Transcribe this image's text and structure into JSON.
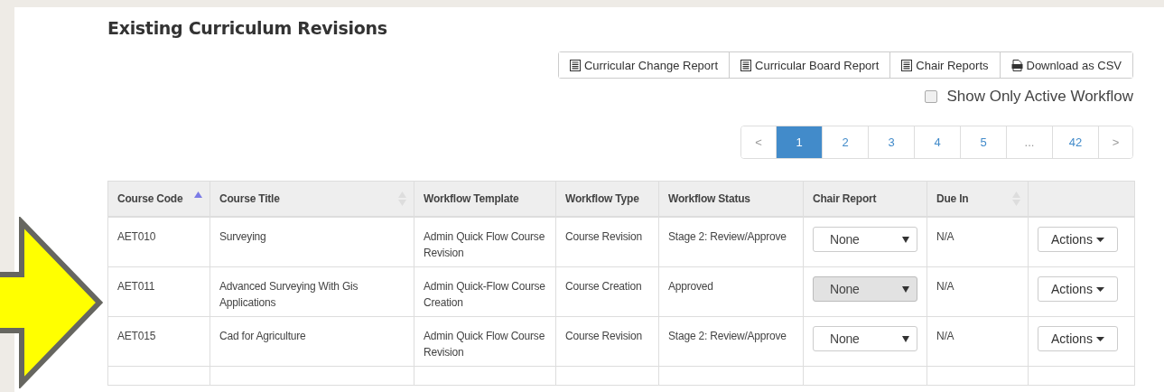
{
  "page": {
    "title": "Existing Curriculum Revisions"
  },
  "report_buttons": [
    {
      "label": "Curricular Change Report",
      "kind": "report"
    },
    {
      "label": "Curricular Board Report",
      "kind": "report"
    },
    {
      "label": "Chair Reports",
      "kind": "report"
    },
    {
      "label": "Download as CSV",
      "kind": "csv"
    }
  ],
  "active_filter": {
    "label": "Show Only Active Workflow",
    "checked": false
  },
  "pagination": [
    {
      "label": "<",
      "selected": false,
      "kind": "nav"
    },
    {
      "label": "1",
      "selected": true,
      "kind": "page"
    },
    {
      "label": "2",
      "selected": false,
      "kind": "page"
    },
    {
      "label": "3",
      "selected": false,
      "kind": "page"
    },
    {
      "label": "4",
      "selected": false,
      "kind": "page"
    },
    {
      "label": "5",
      "selected": false,
      "kind": "page"
    },
    {
      "label": "...",
      "selected": false,
      "kind": "nav"
    },
    {
      "label": "42",
      "selected": false,
      "kind": "page"
    },
    {
      "label": ">",
      "selected": false,
      "kind": "nav"
    }
  ],
  "table": {
    "columns": [
      {
        "label": "Course Code",
        "sortable": true,
        "sorted_ascending": true
      },
      {
        "label": "Course Title",
        "sortable": true,
        "sorted_ascending": false
      },
      {
        "label": "Workflow Template",
        "sortable": false,
        "sorted_ascending": false
      },
      {
        "label": "Workflow Type",
        "sortable": false,
        "sorted_ascending": false
      },
      {
        "label": "Workflow Status",
        "sortable": false,
        "sorted_ascending": false
      },
      {
        "label": "Chair Report",
        "sortable": false,
        "sorted_ascending": false
      },
      {
        "label": "Due In",
        "sortable": true,
        "sorted_ascending": false
      }
    ],
    "rows": [
      {
        "course_code": "AET010",
        "course_title": "Surveying",
        "workflow_template": "Admin Quick Flow Course Revision",
        "workflow_type": "Course Revision",
        "workflow_status": "Stage 2: Review/Approve",
        "chair_report": {
          "value": "None",
          "disabled": false
        },
        "due_in": "N/A",
        "action": "Actions"
      },
      {
        "course_code": "AET011",
        "course_title": "Advanced Surveying With Gis Applications",
        "workflow_template": "Admin Quick-Flow Course Creation",
        "workflow_type": "Course Creation",
        "workflow_status": "Approved",
        "chair_report": {
          "value": "None",
          "disabled": true
        },
        "due_in": "N/A",
        "action": "Actions"
      },
      {
        "course_code": "AET015",
        "course_title": "Cad for Agriculture",
        "workflow_template": "Admin Quick Flow Course Revision",
        "workflow_type": "Course Revision",
        "workflow_status": "Stage 2: Review/Approve",
        "chair_report": {
          "value": "None",
          "disabled": false
        },
        "due_in": "N/A",
        "action": "Actions"
      }
    ]
  }
}
